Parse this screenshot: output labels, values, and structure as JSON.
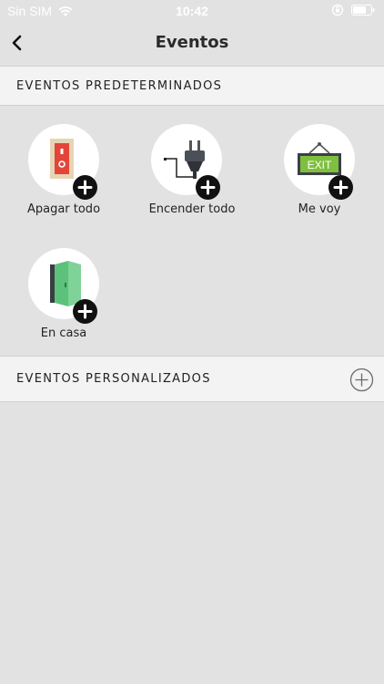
{
  "status": {
    "carrier": "Sin SIM",
    "time": "10:42"
  },
  "nav": {
    "title": "Eventos"
  },
  "preset_section": {
    "label": "EVENTOS PREDETERMINADOS"
  },
  "preset_events": [
    {
      "label": "Apagar todo",
      "icon": "power-switch-icon"
    },
    {
      "label": "Encender todo",
      "icon": "plug-icon"
    },
    {
      "label": "Me voy",
      "icon": "exit-sign-icon"
    },
    {
      "label": "En casa",
      "icon": "door-icon"
    }
  ],
  "exit_sign_text": "EXIT",
  "custom_section": {
    "label": "EVENTOS PERSONALIZADOS"
  },
  "colors": {
    "background": "#e2e2e2",
    "header": "#f3f3f3",
    "badge": "#111111"
  }
}
